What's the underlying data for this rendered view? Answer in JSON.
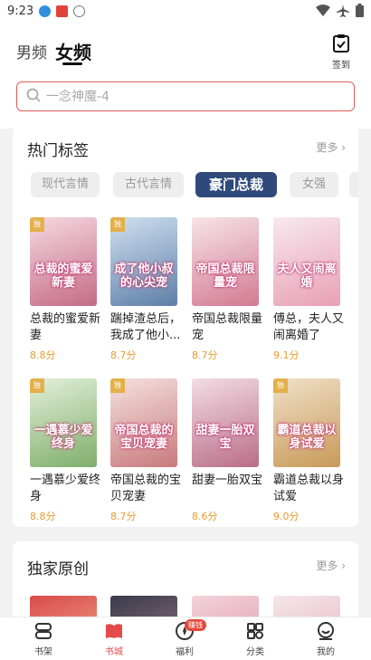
{
  "status_bar": {
    "time": "9:23"
  },
  "header": {
    "tabs": [
      {
        "label": "男频",
        "active": false
      },
      {
        "label": "女频",
        "active": true
      }
    ],
    "checkin_label": "签到"
  },
  "search": {
    "placeholder": "一念神魔-4"
  },
  "hot_tags": {
    "title": "热门标签",
    "more": "更多",
    "tags": [
      {
        "label": "现代言情",
        "active": false
      },
      {
        "label": "古代言情",
        "active": false
      },
      {
        "label": "豪门总裁",
        "active": true
      },
      {
        "label": "女强",
        "active": false
      }
    ],
    "books": [
      {
        "title": "总裁的蜜爱新妻",
        "score": "8.8分",
        "cover_text": "总裁的蜜爱新妻",
        "colors": [
          "#f5d9e0",
          "#c46b85"
        ]
      },
      {
        "title": "踹掉渣总后，我成了他小...",
        "score": "8.7分",
        "cover_text": "成了他小叔的心尖宠",
        "colors": [
          "#cfe0ef",
          "#5e7fa8"
        ]
      },
      {
        "title": "帝国总裁限量宠",
        "score": "8.7分",
        "cover_text": "帝国总裁限量宠",
        "colors": [
          "#f6e4e8",
          "#d37a92"
        ]
      },
      {
        "title": "傅总，夫人又闹离婚了",
        "score": "9.1分",
        "cover_text": "夫人又闹离婚",
        "colors": [
          "#f8e8ee",
          "#e8a0b6"
        ]
      },
      {
        "title": "一遇慕少爱终身",
        "score": "8.8分",
        "cover_text": "一遇慕少爱终身",
        "colors": [
          "#e2f0da",
          "#7fae6a"
        ]
      },
      {
        "title": "帝国总裁的宝贝宠妻",
        "score": "8.7分",
        "cover_text": "帝国总裁的宝贝宠妻",
        "colors": [
          "#f4e1df",
          "#c87a7c"
        ]
      },
      {
        "title": "甜妻一胎双宝",
        "score": "8.6分",
        "cover_text": "甜妻一胎双宝",
        "colors": [
          "#f3dde4",
          "#b96d87"
        ]
      },
      {
        "title": "霸道总裁以身试爱",
        "score": "9.0分",
        "cover_text": "霸道总裁以身试爱",
        "colors": [
          "#f0e0c8",
          "#c89a58"
        ]
      }
    ]
  },
  "exclusive": {
    "title": "独家原创",
    "more": "更多",
    "covers": [
      {
        "colors": [
          "#d94b4b",
          "#f7c8a0"
        ]
      },
      {
        "colors": [
          "#3a3a4a",
          "#b08a90"
        ]
      },
      {
        "colors": [
          "#f3d2dc",
          "#d98aa3"
        ]
      },
      {
        "colors": [
          "#f5e6ea",
          "#e3a5b5"
        ]
      }
    ]
  },
  "bottom_nav": {
    "items": [
      {
        "label": "书架",
        "icon": "bookshelf-icon",
        "active": false
      },
      {
        "label": "书城",
        "icon": "bookstore-icon",
        "active": true
      },
      {
        "label": "福利",
        "icon": "welfare-icon",
        "active": false,
        "badge": "赚钱"
      },
      {
        "label": "分类",
        "icon": "category-icon",
        "active": false
      },
      {
        "label": "我的",
        "icon": "profile-icon",
        "active": false
      }
    ]
  },
  "colors": {
    "accent": "#e44a4a",
    "active_tag": "#2f4a7a",
    "score": "#e79a2c"
  }
}
